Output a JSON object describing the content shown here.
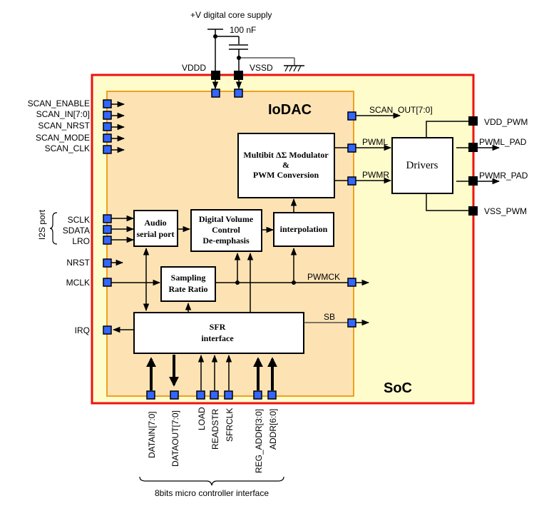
{
  "supply": {
    "label": "+V digital core supply",
    "cap": "100 nF",
    "vddd": "VDDD",
    "vssd": "VSSD"
  },
  "containers": {
    "soc": "SoC",
    "iodac": "IoDAC"
  },
  "colors": {
    "soc_border": "#ee1111",
    "soc_fill": "#fffccc",
    "iodac_border": "#f0a020",
    "iodac_fill": "#fde3b4",
    "pad": "#3366ff"
  },
  "left_pins": {
    "scan": [
      "SCAN_ENABLE",
      "SCAN_IN[7:0]",
      "SCAN_NRST",
      "SCAN_MODE",
      "SCAN_CLK"
    ],
    "i2s_group": "I2S port",
    "i2s": [
      "SCLK",
      "SDATA",
      "LRO"
    ],
    "nrst": "NRST",
    "mclk": "MCLK",
    "irq": "IRQ"
  },
  "blocks": {
    "audio_line1": "Audio",
    "audio_line2": "serial port",
    "dvc_line1": "Digital Volume",
    "dvc_line2": "Control",
    "dvc_line3": "De-emphasis",
    "interp": "interpolation",
    "mod_line1": "Multibit ΔΣ Modulator",
    "mod_line2": "&",
    "mod_line3": "PWM Conversion",
    "srr_line1": "Sampling",
    "srr_line2": "Rate Ratio",
    "sfr_line1": "SFR",
    "sfr_line2": "interface",
    "drivers": "Drivers"
  },
  "signals": {
    "scan_out": "SCAN_OUT[7:0]",
    "pwml": "PWML",
    "pwmr": "PWMR",
    "pwmck": "PWMCK",
    "sb": "SB"
  },
  "right_pins": [
    "VDD_PWM",
    "PWML_PAD",
    "PWMR_PAD",
    "VSS_PWM"
  ],
  "bottom_pins": [
    "DATAIN[7:0]",
    "DATAOUT[7:0]",
    "LOAD",
    "READSTR",
    "SFRCLK",
    "REG_ADDR[3:0]",
    "ADDR[6:0]"
  ],
  "bottom_group": "8bits micro controller interface"
}
